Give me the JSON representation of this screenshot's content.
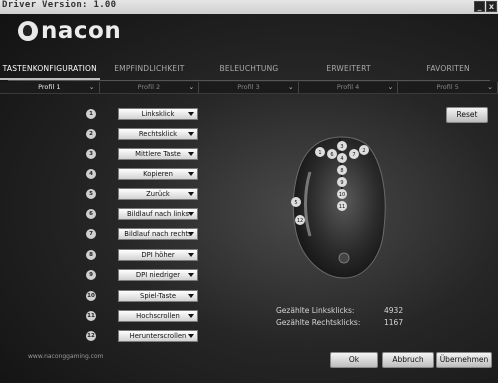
{
  "window": {
    "title": "Driver Version: 1.00",
    "minimize_label": "_",
    "close_label": "x"
  },
  "brand": {
    "logo_text": "nacon",
    "website": "www.naconggaming.com"
  },
  "tabs": [
    {
      "label": "TASTENKONFIGURATION",
      "active": true
    },
    {
      "label": "EMPFINDLICHKEIT",
      "active": false
    },
    {
      "label": "BELEUCHTUNG",
      "active": false
    },
    {
      "label": "ERWEITERT",
      "active": false
    },
    {
      "label": "FAVORITEN",
      "active": false
    }
  ],
  "profiles": [
    {
      "label": "Profil 1",
      "active": true
    },
    {
      "label": "Profil 2",
      "active": false
    },
    {
      "label": "Profil 3",
      "active": false
    },
    {
      "label": "Profil 4",
      "active": false
    },
    {
      "label": "Profil 5",
      "active": false
    }
  ],
  "reset_label": "Reset",
  "buttons": [
    {
      "num": "1",
      "assignment": "Linksklick"
    },
    {
      "num": "2",
      "assignment": "Rechtsklick"
    },
    {
      "num": "3",
      "assignment": "Mittlere Taste"
    },
    {
      "num": "4",
      "assignment": "Kopieren"
    },
    {
      "num": "5",
      "assignment": "Zurück"
    },
    {
      "num": "6",
      "assignment": "Bildlauf nach links"
    },
    {
      "num": "7",
      "assignment": "Bildlauf nach rechts"
    },
    {
      "num": "8",
      "assignment": "DPI höher"
    },
    {
      "num": "9",
      "assignment": "DPI niedriger"
    },
    {
      "num": "10",
      "assignment": "Spiel-Taste"
    },
    {
      "num": "11",
      "assignment": "Hochscrollen"
    },
    {
      "num": "12",
      "assignment": "Herunterscrollen"
    }
  ],
  "stats": {
    "left_clicks_label": "Gezählte Linksklicks:",
    "left_clicks_value": "4932",
    "right_clicks_label": "Gezählte Rechtsklicks:",
    "right_clicks_value": "1167"
  },
  "footer": {
    "ok_label": "Ok",
    "cancel_label": "Abbruch",
    "apply_label": "Übernehmen"
  },
  "colors": {
    "background": "#1a1a1a",
    "button_face": "#e8e8e8",
    "accent_text": "#ffffff"
  }
}
